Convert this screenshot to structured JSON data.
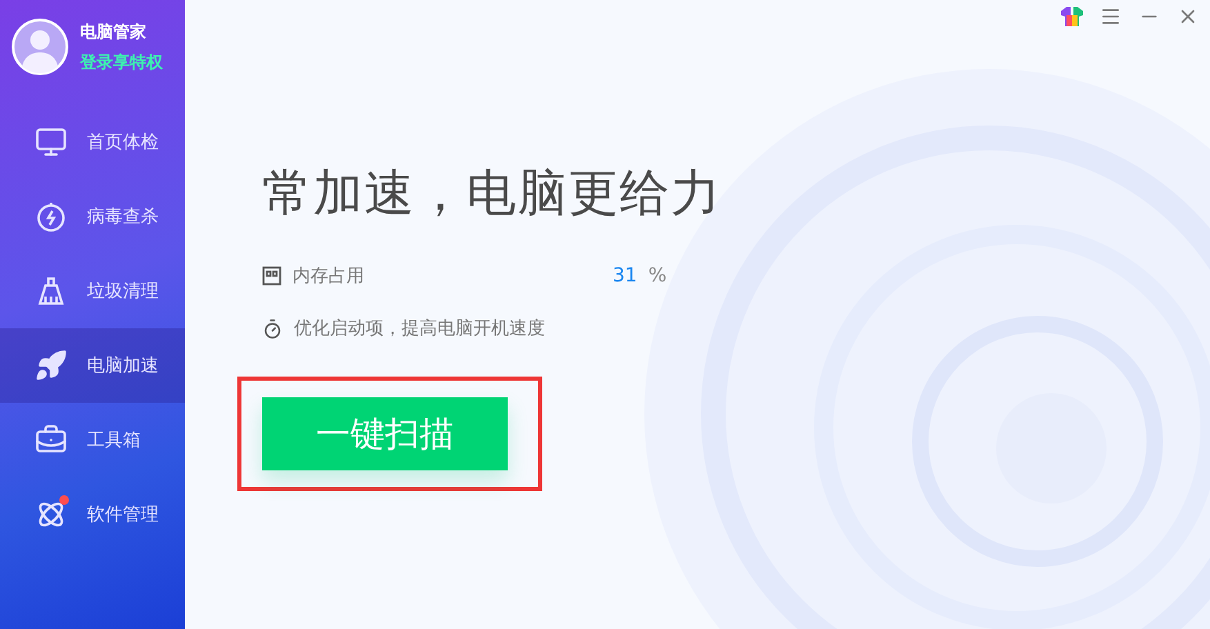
{
  "profile": {
    "name": "电脑管家",
    "login_link": "登录享特权"
  },
  "sidebar": {
    "items": [
      {
        "label": "首页体检",
        "selected": false
      },
      {
        "label": "病毒查杀",
        "selected": false
      },
      {
        "label": "垃圾清理",
        "selected": false
      },
      {
        "label": "电脑加速",
        "selected": true
      },
      {
        "label": "工具箱",
        "selected": false
      },
      {
        "label": "软件管理",
        "selected": false,
        "badge": true
      }
    ]
  },
  "main": {
    "headline": "常加速，电脑更给力",
    "memory": {
      "label": "内存占用",
      "value": "31",
      "unit": "%"
    },
    "tip": "优化启动项，提高电脑开机速度",
    "scan_button": "一键扫描"
  }
}
